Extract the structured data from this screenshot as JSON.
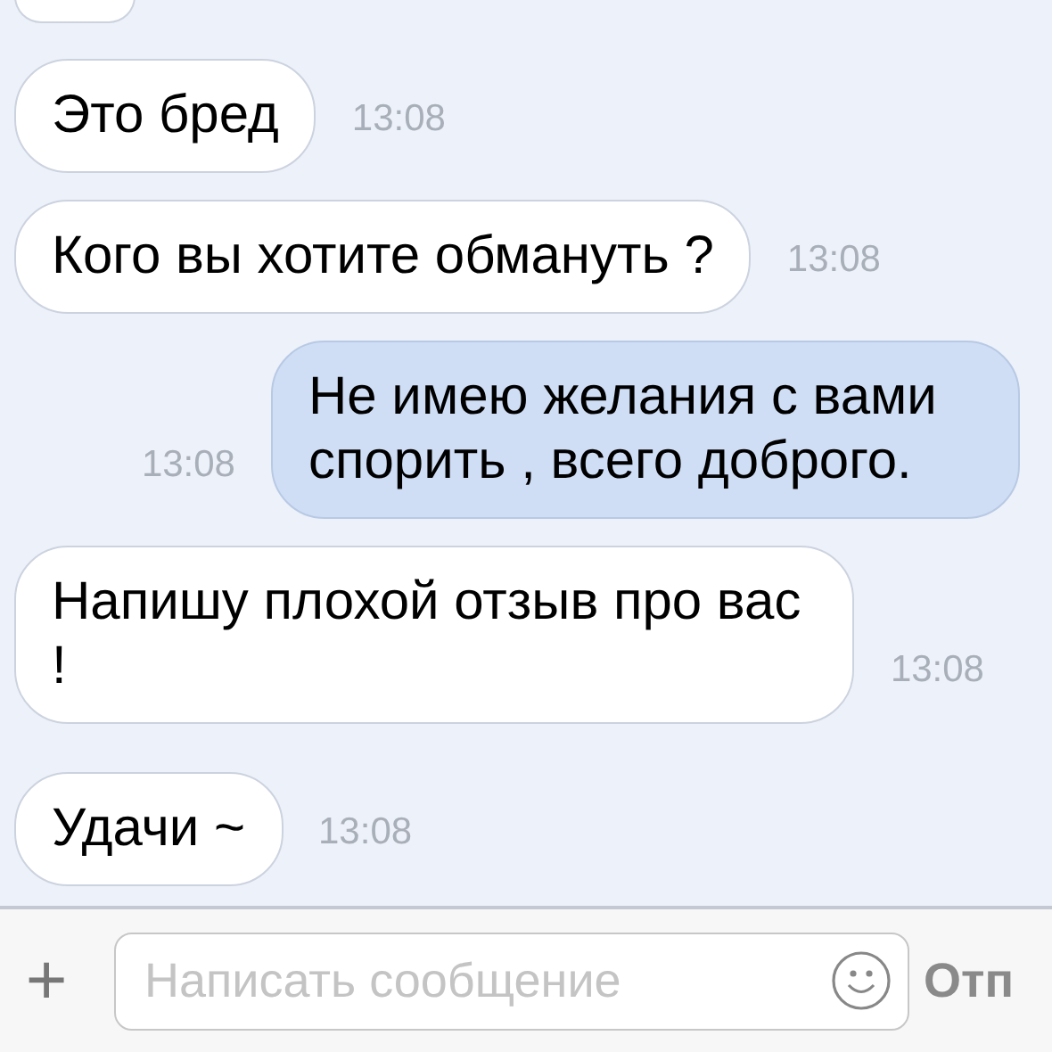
{
  "messages": [
    {
      "kind": "partial"
    },
    {
      "kind": "incoming",
      "text": "Это бред",
      "time": "13:08"
    },
    {
      "kind": "incoming",
      "text": "Кого вы хотите обмануть ?",
      "time": "13:08"
    },
    {
      "kind": "outgoing",
      "text": "Не имею желания с вами спорить , всего доброго.",
      "time": "13:08"
    },
    {
      "kind": "incoming",
      "text": "Напишу плохой отзыв про вас !",
      "time": "13:08"
    },
    {
      "kind": "incoming",
      "text": "Удачи ~",
      "time": "13:08"
    }
  ],
  "composer": {
    "attach_icon": "+",
    "placeholder": "Написать сообщение",
    "send": "Отп"
  }
}
